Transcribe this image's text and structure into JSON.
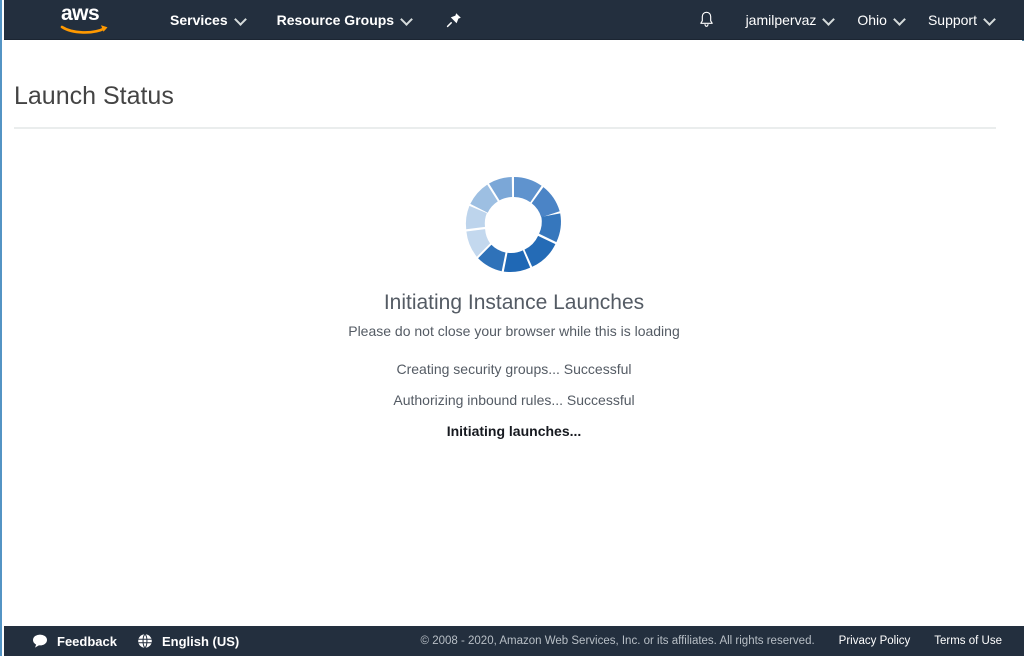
{
  "nav": {
    "logo_text": "aws",
    "logo_name": "aws-logo",
    "services_label": "Services",
    "resource_groups_label": "Resource Groups",
    "pin_icon": "pushpin-icon",
    "bell_icon": "bell-icon",
    "account_label": "jamilpervaz",
    "region_label": "Ohio",
    "support_label": "Support"
  },
  "header": {
    "title": "Launch Status"
  },
  "main": {
    "spinner_icon": "loading-spinner-icon",
    "heading": "Initiating Instance Launches",
    "subtext": "Please do not close your browser while this is loading",
    "steps": [
      {
        "label": "Creating security groups... Successful",
        "state": "done"
      },
      {
        "label": "Authorizing inbound rules... Successful",
        "state": "done"
      },
      {
        "label": "Initiating launches...",
        "state": "active"
      }
    ]
  },
  "footer": {
    "feedback_label": "Feedback",
    "feedback_icon": "speech-bubble-icon",
    "language_label": "English (US)",
    "language_icon": "globe-icon",
    "copyright": "© 2008 - 2020, Amazon Web Services, Inc. or its affiliates. All rights reserved.",
    "privacy_label": "Privacy Policy",
    "terms_label": "Terms of Use"
  },
  "colors": {
    "nav_background": "#232f3e",
    "page_background": "#ffffff",
    "text_primary": "#545b64",
    "text_dark": "#16191f",
    "spinner_light": "#bdd4ec",
    "spinner_mid": "#6b9bd2",
    "spinner_dark": "#1f68b5"
  },
  "spinner_segments": [
    {
      "index": 0,
      "color": "#5f93ce"
    },
    {
      "index": 1,
      "color": "#4b84c6"
    },
    {
      "index": 2,
      "color": "#3677bd"
    },
    {
      "index": 3,
      "color": "#246bb6"
    },
    {
      "index": 4,
      "color": "#1f68b5"
    },
    {
      "index": 5,
      "color": "#2f72b9"
    },
    {
      "index": 6,
      "color": "#c3d8ee"
    },
    {
      "index": 7,
      "color": "#bdd4ec"
    },
    {
      "index": 8,
      "color": "#9dbfe2"
    },
    {
      "index": 9,
      "color": "#7ba7d7"
    }
  ]
}
